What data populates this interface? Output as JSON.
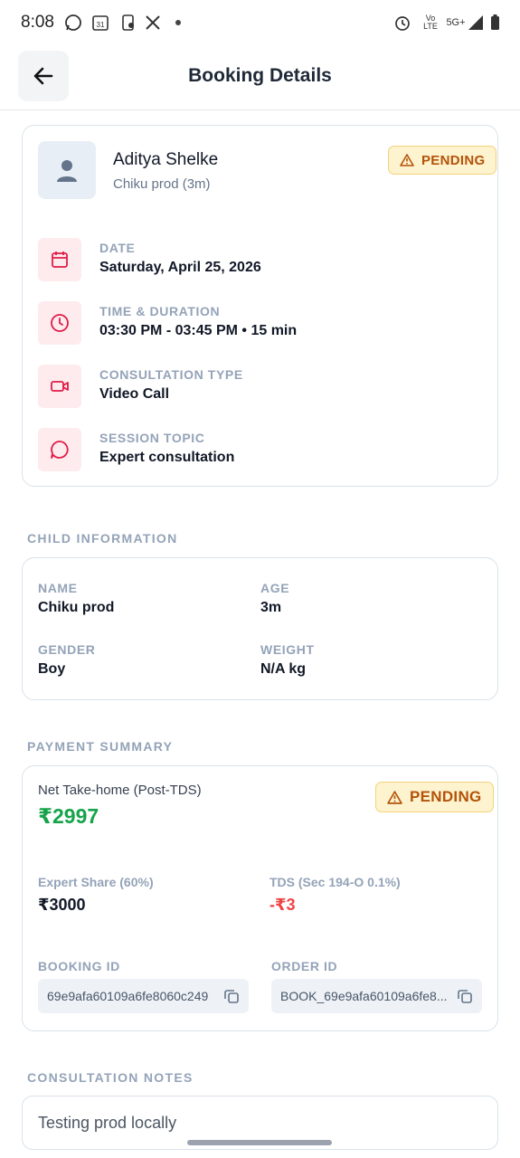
{
  "status_bar": {
    "time": "8:08",
    "icons": [
      "whatsapp-icon",
      "calendar-icon",
      "app-icon",
      "x-icon",
      "alarm-icon",
      "volte-icon",
      "signal-icon",
      "battery-icon"
    ],
    "network": "5G+"
  },
  "header": {
    "title": "Booking Details",
    "back_icon": "arrow-left-icon"
  },
  "booking": {
    "user_name": "Aditya Shelke",
    "child_info": "Chiku prod (3m)",
    "status": "PENDING",
    "items": [
      {
        "label": "DATE",
        "value": "Saturday, April 25, 2026",
        "icon": "calendar-icon"
      },
      {
        "label": "TIME & DURATION",
        "value": "03:30 PM - 03:45 PM • 15 min",
        "icon": "clock-icon"
      },
      {
        "label": "CONSULTATION TYPE",
        "value": "Video Call",
        "icon": "video-icon"
      },
      {
        "label": "SESSION TOPIC",
        "value": "Expert consultation",
        "icon": "chat-icon"
      }
    ]
  },
  "child_information": {
    "title": "CHILD INFORMATION",
    "name_label": "NAME",
    "name": "Chiku prod",
    "age_label": "AGE",
    "age": "3m",
    "gender_label": "GENDER",
    "gender": "Boy",
    "weight_label": "WEIGHT",
    "weight": "N/A kg"
  },
  "payment_summary": {
    "title": "PAYMENT SUMMARY",
    "net_label": "Net Take-home (Post-TDS)",
    "net_amount": "₹2997",
    "status": "PENDING",
    "expert_share_label": "Expert Share (60%)",
    "expert_share": "₹3000",
    "tds_label": "TDS (Sec 194-O 0.1%)",
    "tds": "-₹3",
    "booking_id_label": "BOOKING ID",
    "booking_id": "69e9afa60109a6fe8060c249",
    "order_id_label": "ORDER ID",
    "order_id": "BOOK_69e9afa60109a6fe8..."
  },
  "notes": {
    "title": "CONSULTATION NOTES",
    "text": "Testing prod locally"
  },
  "colors": {
    "accent_red": "#e11d48",
    "pending_bg": "#fdf3cf",
    "pending_text": "#b45309",
    "green": "#16a34a",
    "negative": "#ef4444"
  }
}
